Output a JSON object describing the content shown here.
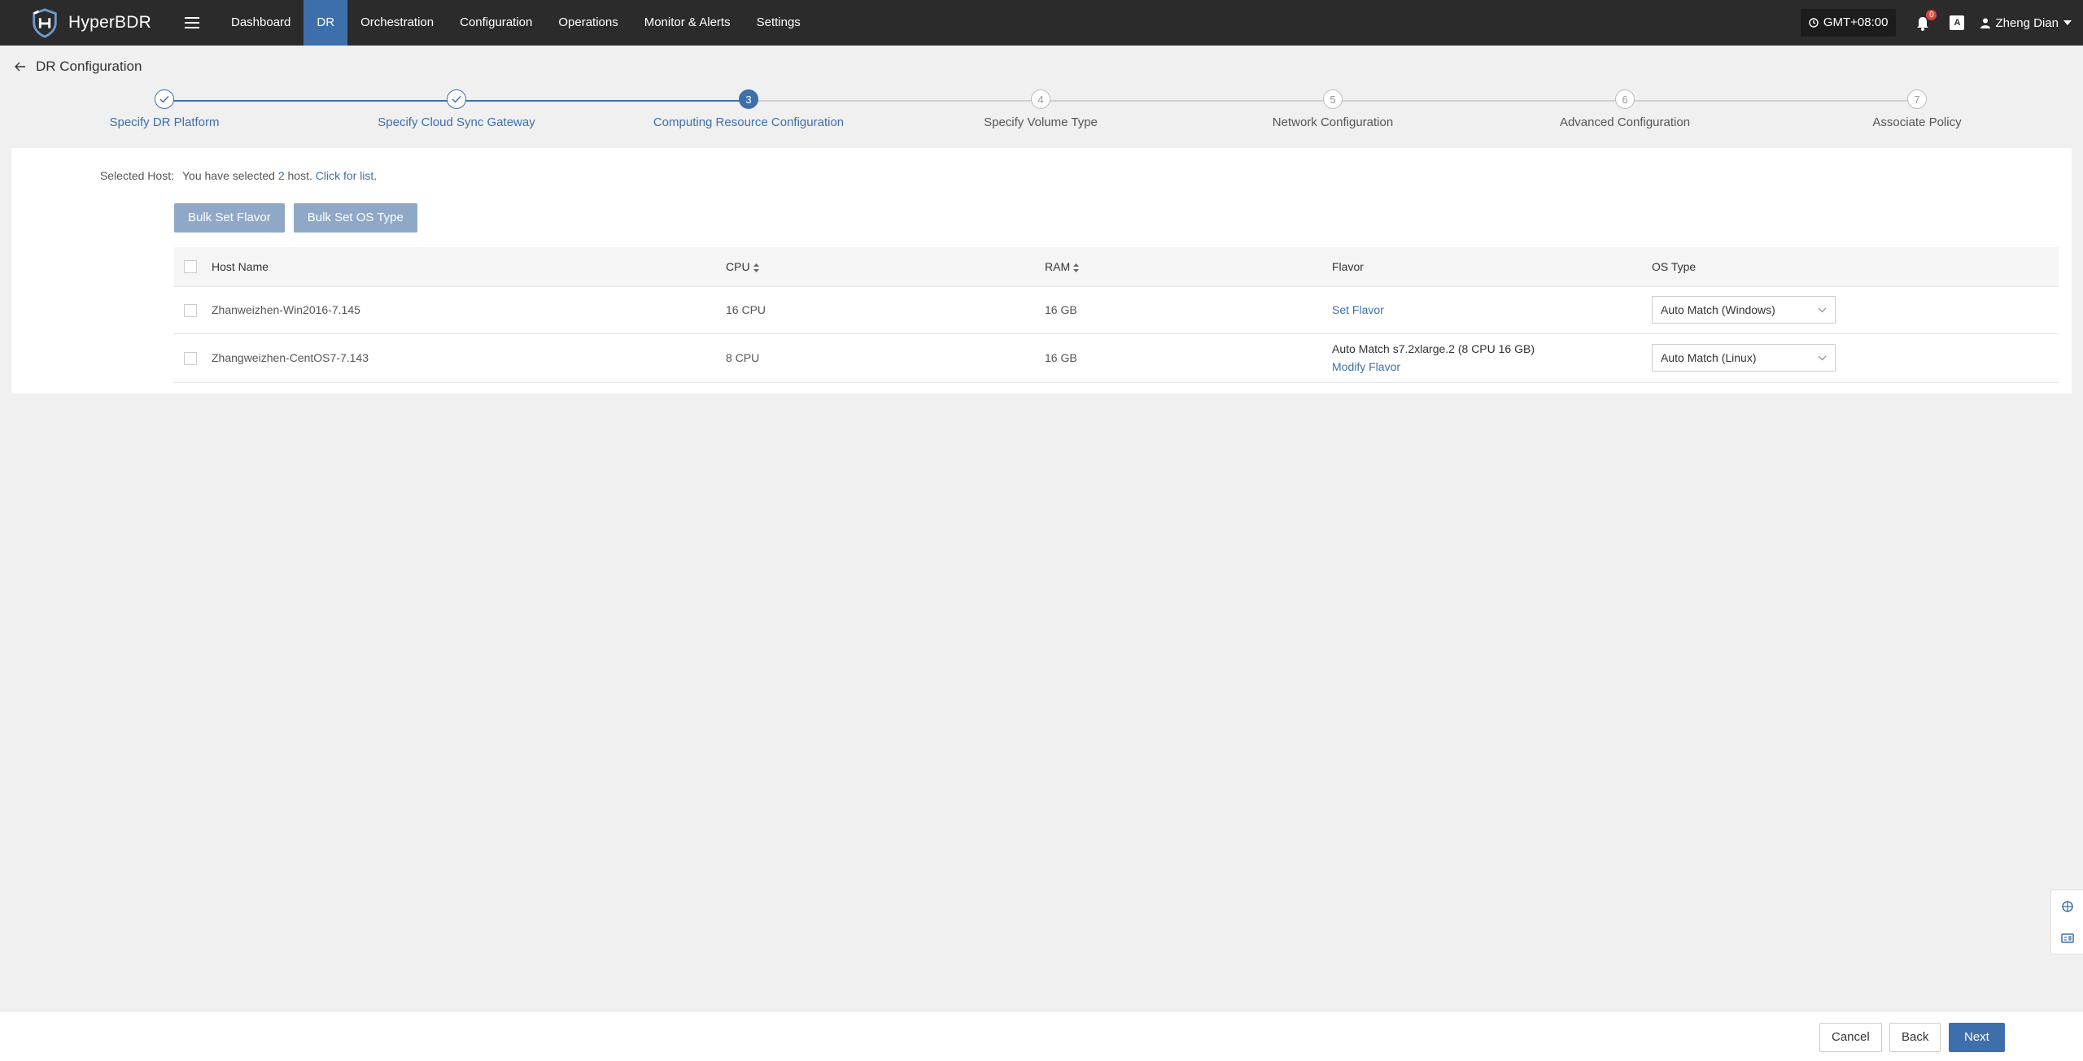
{
  "app": {
    "name": "HyperBDR"
  },
  "nav": {
    "items": [
      {
        "label": "Dashboard",
        "active": false
      },
      {
        "label": "DR",
        "active": true
      },
      {
        "label": "Orchestration",
        "active": false
      },
      {
        "label": "Configuration",
        "active": false
      },
      {
        "label": "Operations",
        "active": false
      },
      {
        "label": "Monitor & Alerts",
        "active": false
      },
      {
        "label": "Settings",
        "active": false
      }
    ]
  },
  "topbar": {
    "timezone": "GMT+08:00",
    "notification_count": "0",
    "lang_icon_text": "A",
    "user_name": "Zheng Dian"
  },
  "page": {
    "title": "DR Configuration"
  },
  "steps": [
    {
      "label": "Specify DR Platform",
      "status": "done",
      "number": "1"
    },
    {
      "label": "Specify Cloud Sync Gateway",
      "status": "done",
      "number": "2"
    },
    {
      "label": "Computing Resource Configuration",
      "status": "current",
      "number": "3"
    },
    {
      "label": "Specify Volume Type",
      "status": "pending",
      "number": "4"
    },
    {
      "label": "Network Configuration",
      "status": "pending",
      "number": "5"
    },
    {
      "label": "Advanced Configuration",
      "status": "pending",
      "number": "6"
    },
    {
      "label": "Associate Policy",
      "status": "pending",
      "number": "7"
    }
  ],
  "selected": {
    "label": "Selected Host:",
    "prefix": "You have selected",
    "count": "2",
    "suffix": "host.",
    "link": "Click for list",
    "end": "."
  },
  "bulk": {
    "set_flavor": "Bulk Set Flavor",
    "set_os_type": "Bulk Set OS Type"
  },
  "table": {
    "headers": {
      "host_name": "Host Name",
      "cpu": "CPU",
      "ram": "RAM",
      "flavor": "Flavor",
      "os_type": "OS Type"
    },
    "rows": [
      {
        "host_name": "Zhanweizhen-Win2016-7.145",
        "cpu": "16 CPU",
        "ram": "16 GB",
        "flavor_text": "",
        "flavor_link": "Set Flavor",
        "os_type": "Auto Match (Windows)"
      },
      {
        "host_name": "Zhangweizhen-CentOS7-7.143",
        "cpu": "8 CPU",
        "ram": "16 GB",
        "flavor_text": "Auto Match s7.2xlarge.2 (8 CPU 16 GB)",
        "flavor_link": "Modify Flavor",
        "os_type": "Auto Match (Linux)"
      }
    ]
  },
  "footer": {
    "cancel": "Cancel",
    "back": "Back",
    "next": "Next"
  },
  "colors": {
    "primary": "#3d6fad",
    "topbar": "#2b2b2b",
    "bulk_button": "#8fa8c8"
  },
  "icons": [
    "shield-logo-icon",
    "hamburger-icon",
    "clock-icon",
    "bell-icon",
    "translate-icon",
    "user-icon",
    "caret-down-icon",
    "back-arrow-icon",
    "check-icon",
    "sort-icon",
    "chevron-down-icon",
    "support-icon",
    "guide-icon"
  ]
}
